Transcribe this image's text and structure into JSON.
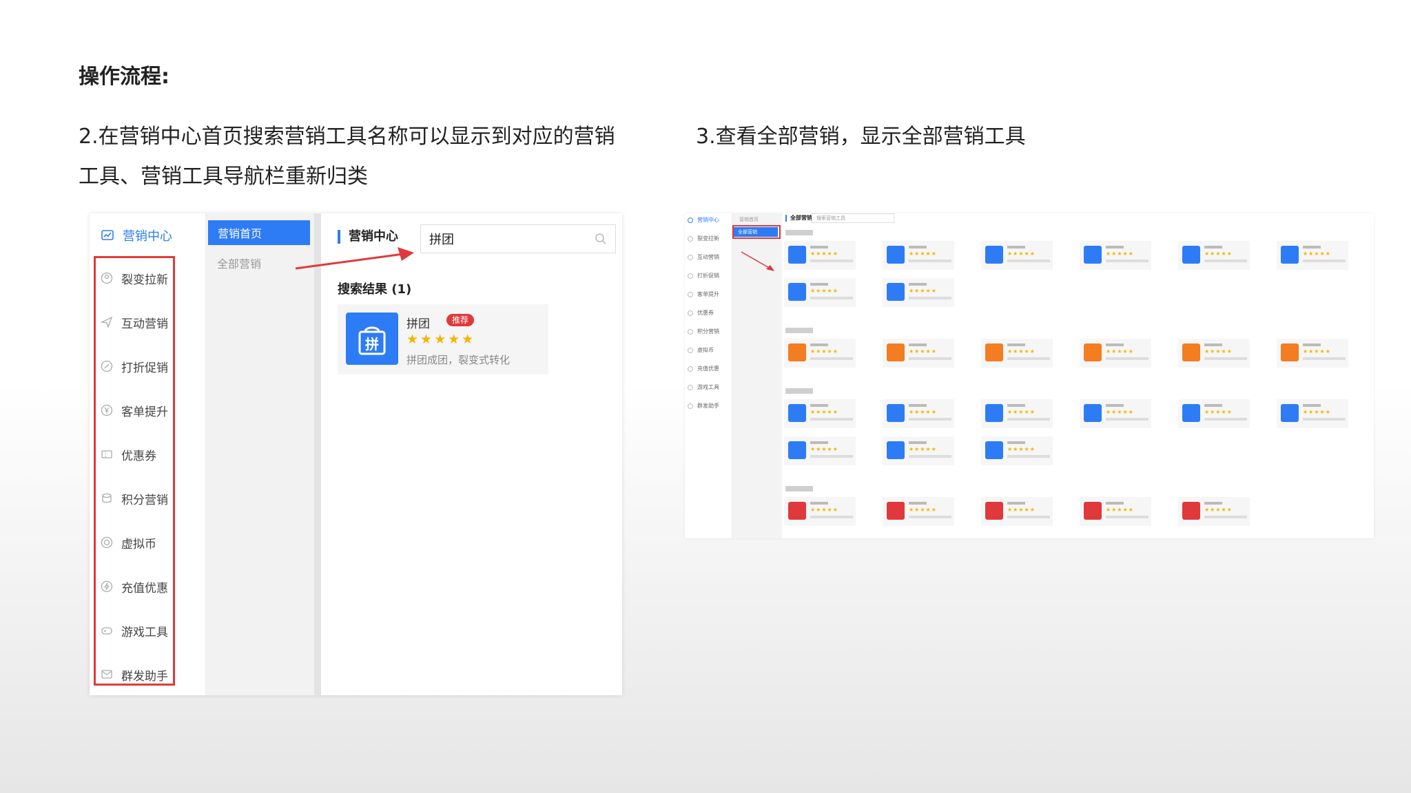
{
  "title": "操作流程:",
  "steps": {
    "step2": "2.在营销中心首页搜索营销工具名称可以显示到对应的营销工具、营销工具导航栏重新归类",
    "step3": "3.查看全部营销，显示全部营销工具"
  },
  "left_shot": {
    "sidebar": {
      "header": "营销中心",
      "items": [
        "裂变拉新",
        "互动营销",
        "打折促销",
        "客单提升",
        "优惠券",
        "积分营销",
        "虚拟币",
        "充值优惠",
        "游戏工具",
        "群发助手"
      ]
    },
    "subnav": {
      "active": "营销首页",
      "all": "全部营销"
    },
    "main": {
      "title": "营销中心",
      "search_value": "拼团",
      "results_title": "搜索结果 (1)",
      "result": {
        "icon_char": "拼",
        "name": "拼团",
        "badge": "推荐",
        "stars": "★★★★★",
        "desc": "拼团成团，裂变式转化"
      }
    }
  },
  "right_shot": {
    "sidebar_items": [
      "营销中心",
      "裂变拉新",
      "互动营销",
      "打折促销",
      "客单提升",
      "优惠券",
      "积分营销",
      "虚拟币",
      "充值优惠",
      "游戏工具",
      "群发助手"
    ],
    "subnav": {
      "home": "营销首页",
      "all": "全部营销"
    },
    "header": "全部营销",
    "search_placeholder": "搜索营销工具",
    "colors": {
      "blue": "#2d7cf6",
      "orange": "#f47c21",
      "red": "#e0393b"
    }
  }
}
